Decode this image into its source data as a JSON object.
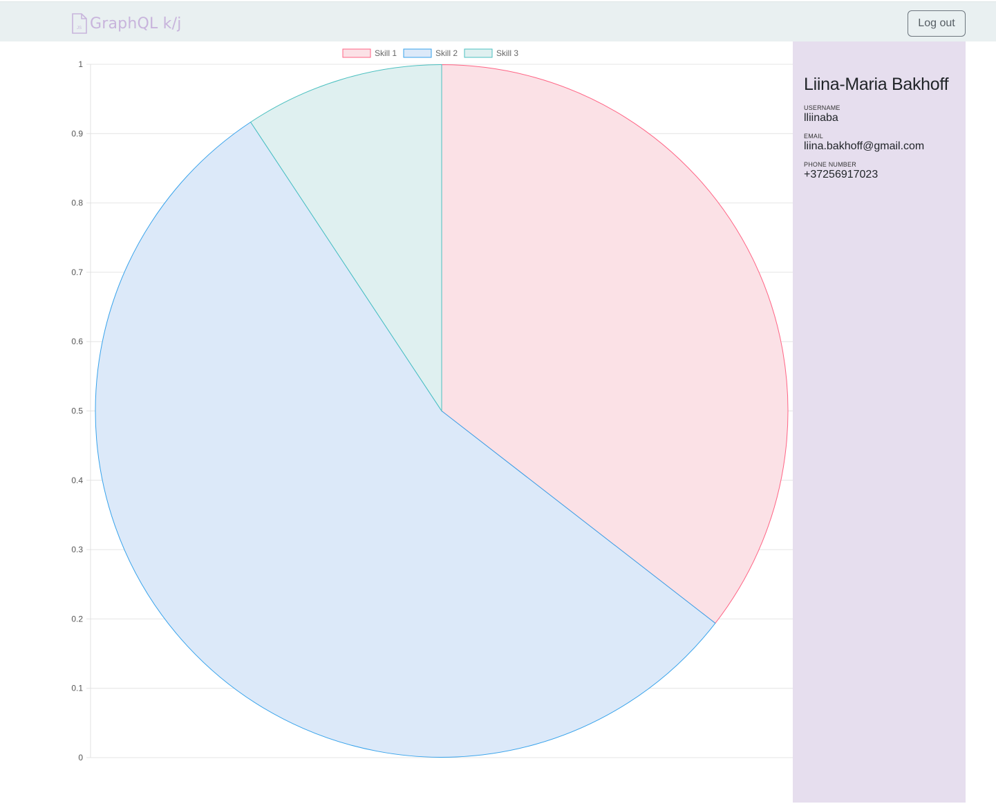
{
  "header": {
    "brand_text": "GraphQL k/j",
    "brand_icon": "js-file-icon",
    "logout_label": "Log out"
  },
  "profile": {
    "name": "Liina-Maria Bakhoff",
    "username_label": "USERNAME",
    "username": "lliinaba",
    "email_label": "EMAIL",
    "email": "liina.bakhoff@gmail.com",
    "phone_label": "PHONE NUMBER",
    "phone": "+37256917023"
  },
  "colors": {
    "topbar_bg": "#e9f0f1",
    "sidebar_bg": "#e6deee",
    "brand": "#c8b4dc"
  },
  "chart_data": {
    "type": "pie",
    "legend_position": "top",
    "grid": true,
    "ylim": [
      0,
      1
    ],
    "y_ticks": [
      "0",
      "0.1",
      "0.2",
      "0.3",
      "0.4",
      "0.5",
      "0.6",
      "0.7",
      "0.8",
      "0.9",
      "1"
    ],
    "series": [
      {
        "name": "Skill 1",
        "value": 0.355,
        "fill": "#fbe1e6",
        "stroke": "#ff6384"
      },
      {
        "name": "Skill 2",
        "value": 0.552,
        "fill": "#dce9f9",
        "stroke": "#36a2eb"
      },
      {
        "name": "Skill 3",
        "value": 0.093,
        "fill": "#dff0f0",
        "stroke": "#4bc0c0"
      }
    ]
  }
}
